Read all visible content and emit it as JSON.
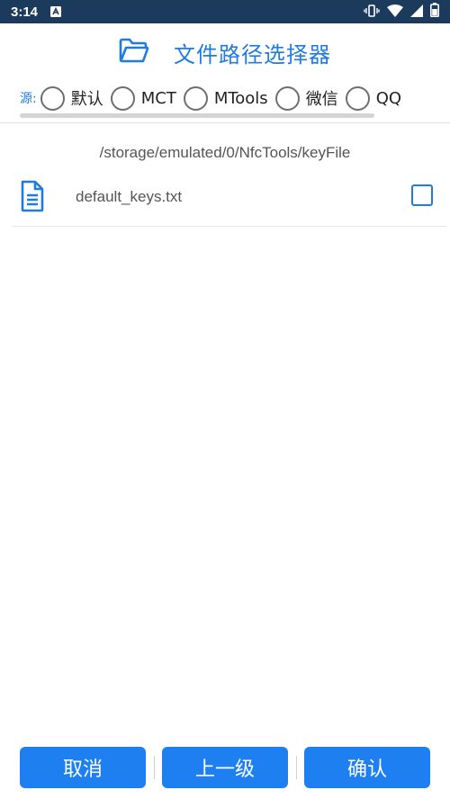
{
  "status_bar": {
    "time": "3:14",
    "icons": [
      "notification-a-icon",
      "vibrate-icon",
      "wifi-icon",
      "signal-icon",
      "battery-icon"
    ]
  },
  "header": {
    "title": "文件路径选择器",
    "icon": "folder-open-icon"
  },
  "source": {
    "label": "源:",
    "options": [
      {
        "label": "默认",
        "selected": false
      },
      {
        "label": "MCT",
        "selected": false
      },
      {
        "label": "MTools",
        "selected": false
      },
      {
        "label": "微信",
        "selected": false
      },
      {
        "label": "QQ",
        "selected": false
      }
    ]
  },
  "current_path": "/storage/emulated/0/NfcTools/keyFile",
  "files": [
    {
      "name": "default_keys.txt",
      "icon": "file-text-icon",
      "checked": false
    }
  ],
  "buttons": {
    "cancel": "取消",
    "up": "上一级",
    "confirm": "确认"
  },
  "colors": {
    "accent": "#1f7be0",
    "button": "#1e80f0",
    "status_bar": "#1c3a5c"
  }
}
